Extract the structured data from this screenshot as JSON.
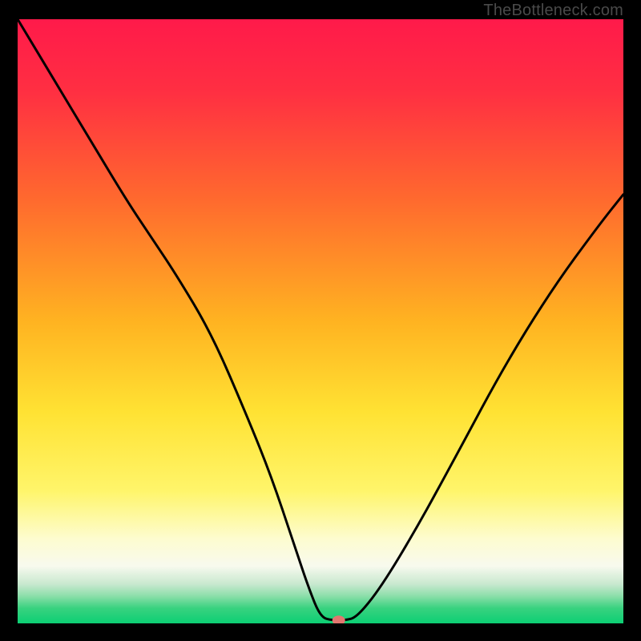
{
  "watermark": "TheBottleneck.com",
  "marker": {
    "color": "#e2766f",
    "radius_x": 8,
    "radius_y": 6
  },
  "curve_stroke": "#000000",
  "curve_width": 3,
  "gradient_stops": [
    {
      "offset": 0.0,
      "color": "#ff1a4a"
    },
    {
      "offset": 0.12,
      "color": "#ff2f42"
    },
    {
      "offset": 0.3,
      "color": "#ff6a2e"
    },
    {
      "offset": 0.5,
      "color": "#ffb321"
    },
    {
      "offset": 0.65,
      "color": "#ffe233"
    },
    {
      "offset": 0.78,
      "color": "#fff56a"
    },
    {
      "offset": 0.86,
      "color": "#fdfccf"
    },
    {
      "offset": 0.905,
      "color": "#f8faee"
    },
    {
      "offset": 0.935,
      "color": "#c8e8cf"
    },
    {
      "offset": 0.955,
      "color": "#8bdea9"
    },
    {
      "offset": 0.975,
      "color": "#38d27f"
    },
    {
      "offset": 1.0,
      "color": "#0ccf74"
    }
  ],
  "chart_data": {
    "type": "line",
    "title": "",
    "xlabel": "",
    "ylabel": "",
    "xlim": [
      0,
      100
    ],
    "ylim": [
      0,
      100
    ],
    "series": [
      {
        "name": "bottleneck-curve",
        "x": [
          0,
          6,
          12,
          18,
          22,
          26,
          32,
          38,
          42,
          46,
          48,
          50,
          52,
          54,
          56,
          60,
          66,
          72,
          80,
          88,
          96,
          100
        ],
        "y": [
          100,
          90,
          80,
          70,
          64,
          58,
          48,
          34,
          24,
          12,
          6,
          1,
          0.5,
          0.5,
          1,
          6,
          16,
          27,
          42,
          55,
          66,
          71
        ]
      }
    ],
    "annotations": [
      {
        "name": "minimum-marker",
        "x": 53,
        "y": 0.5
      }
    ],
    "legend": false,
    "grid": false
  }
}
